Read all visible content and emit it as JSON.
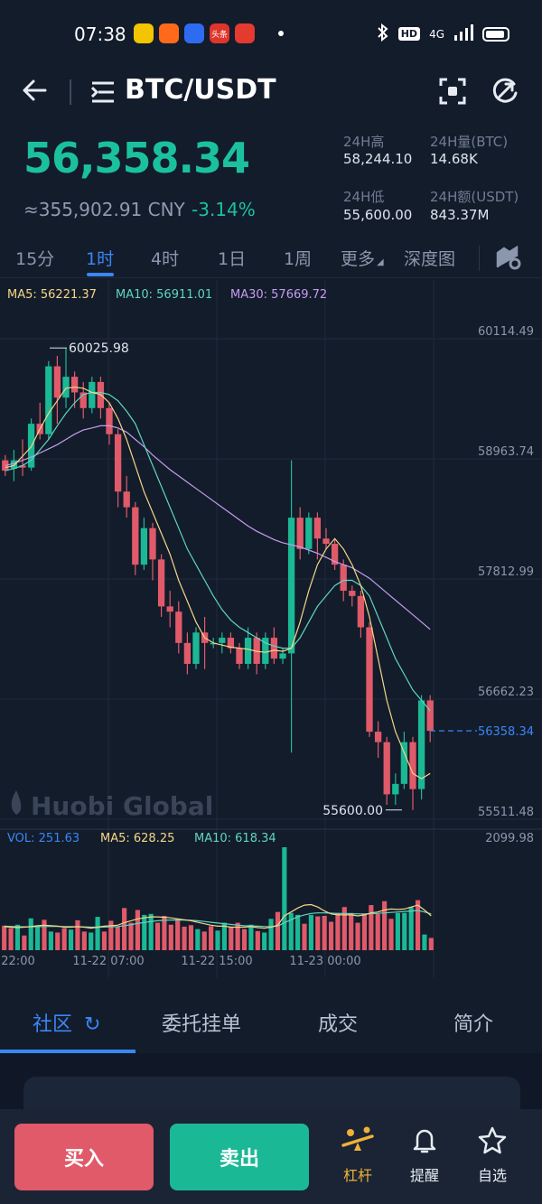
{
  "status": {
    "time": "07:38",
    "apps": [
      {
        "name": "chrome-app-icon",
        "color": "#f2c500"
      },
      {
        "name": "taobao-app-icon",
        "color": "#ff6a1a"
      },
      {
        "name": "baidu-app-icon",
        "color": "#2d6cf0"
      },
      {
        "name": "toutiao-app-icon",
        "color": "#e0352b",
        "label": "头条"
      },
      {
        "name": "video-app-icon",
        "color": "#e43a2f"
      }
    ],
    "network": "4G"
  },
  "header": {
    "pair": "BTC/USDT"
  },
  "price": {
    "last": "56,358.34",
    "cny": "≈355,902.91 CNY",
    "change": "-3.14%"
  },
  "stats": {
    "high_label": "24H高",
    "high_value": "58,244.10",
    "vol_label": "24H量(BTC)",
    "vol_value": "14.68K",
    "low_label": "24H低",
    "low_value": "55,600.00",
    "amt_label": "24H额(USDT)",
    "amt_value": "843.37M"
  },
  "tabs": [
    "15分",
    "1时",
    "4时",
    "1日",
    "1周",
    "更多",
    "深度图"
  ],
  "active_tab": "1时",
  "chart_data": {
    "type": "candlestick",
    "ma_legend": {
      "ma5": "MA5: 56221.37",
      "ma10": "MA10: 56911.01",
      "ma30": "MA30: 57669.72"
    },
    "ma_colors": {
      "ma5": "#f5d787",
      "ma10": "#5fd6c0",
      "ma30": "#c69cf0"
    },
    "up_color": "#1bb895",
    "down_color": "#e05a6a",
    "price_axis": [
      "60114.49",
      "58963.74",
      "57812.99",
      "56662.23",
      "55511.48"
    ],
    "price_axis_values": [
      60114.49,
      58963.74,
      57812.99,
      56662.23,
      55511.48
    ],
    "ylim": [
      55511.48,
      60114.49
    ],
    "last_price": "56358.34",
    "last_price_value": 56358.34,
    "max_label": "60025.98",
    "max_label_value": 60025.98,
    "min_label": "55600.00",
    "min_label_value": 55600.0,
    "watermark": "Huobi Global",
    "candles": [
      {
        "o": 58950,
        "c": 58850,
        "h": 59000,
        "l": 58800
      },
      {
        "o": 58870,
        "c": 58950,
        "h": 59050,
        "l": 58750
      },
      {
        "o": 58900,
        "c": 58880,
        "h": 59150,
        "l": 58800
      },
      {
        "o": 58880,
        "c": 59300,
        "h": 59350,
        "l": 58850
      },
      {
        "o": 59300,
        "c": 59200,
        "h": 59500,
        "l": 59150
      },
      {
        "o": 59200,
        "c": 59850,
        "h": 59900,
        "l": 59150
      },
      {
        "o": 59850,
        "c": 59550,
        "h": 59950,
        "l": 59300
      },
      {
        "o": 59550,
        "c": 59750,
        "h": 60026,
        "l": 59450
      },
      {
        "o": 59750,
        "c": 59600,
        "h": 59800,
        "l": 59450
      },
      {
        "o": 59600,
        "c": 59450,
        "h": 59700,
        "l": 59350
      },
      {
        "o": 59450,
        "c": 59700,
        "h": 59750,
        "l": 59400
      },
      {
        "o": 59700,
        "c": 59450,
        "h": 59750,
        "l": 59350
      },
      {
        "o": 59450,
        "c": 59200,
        "h": 59500,
        "l": 59100
      },
      {
        "o": 59200,
        "c": 58650,
        "h": 59250,
        "l": 58500
      },
      {
        "o": 58650,
        "c": 58500,
        "h": 58800,
        "l": 58400
      },
      {
        "o": 58500,
        "c": 57950,
        "h": 58550,
        "l": 57850
      },
      {
        "o": 57950,
        "c": 58300,
        "h": 58400,
        "l": 57900
      },
      {
        "o": 58300,
        "c": 58000,
        "h": 58350,
        "l": 57800
      },
      {
        "o": 58000,
        "c": 57550,
        "h": 58050,
        "l": 57450
      },
      {
        "o": 57550,
        "c": 57500,
        "h": 57700,
        "l": 57350
      },
      {
        "o": 57500,
        "c": 57200,
        "h": 57600,
        "l": 57100
      },
      {
        "o": 57200,
        "c": 57000,
        "h": 57300,
        "l": 56900
      },
      {
        "o": 57000,
        "c": 57300,
        "h": 57350,
        "l": 56950
      },
      {
        "o": 57300,
        "c": 57200,
        "h": 57450,
        "l": 56950
      },
      {
        "o": 57200,
        "c": 57200,
        "h": 57250,
        "l": 57150
      },
      {
        "o": 57200,
        "c": 57250,
        "h": 57300,
        "l": 57100
      },
      {
        "o": 57250,
        "c": 57150,
        "h": 57300,
        "l": 57100
      },
      {
        "o": 57150,
        "c": 57000,
        "h": 57200,
        "l": 56950
      },
      {
        "o": 57000,
        "c": 57250,
        "h": 57350,
        "l": 56950
      },
      {
        "o": 57250,
        "c": 57000,
        "h": 57300,
        "l": 56900
      },
      {
        "o": 57000,
        "c": 57250,
        "h": 57300,
        "l": 56950
      },
      {
        "o": 57250,
        "c": 57050,
        "h": 57350,
        "l": 57000
      },
      {
        "o": 57050,
        "c": 57100,
        "h": 57150,
        "l": 57000
      },
      {
        "o": 57100,
        "c": 58400,
        "h": 58950,
        "l": 56150
      },
      {
        "o": 58400,
        "c": 58100,
        "h": 58500,
        "l": 58000
      },
      {
        "o": 58100,
        "c": 58400,
        "h": 58450,
        "l": 58050
      },
      {
        "o": 58400,
        "c": 58200,
        "h": 58450,
        "l": 58000
      },
      {
        "o": 58200,
        "c": 58150,
        "h": 58300,
        "l": 58100
      },
      {
        "o": 58150,
        "c": 57950,
        "h": 58200,
        "l": 57900
      },
      {
        "o": 57950,
        "c": 57700,
        "h": 58000,
        "l": 57600
      },
      {
        "o": 57700,
        "c": 57650,
        "h": 57750,
        "l": 57550
      },
      {
        "o": 57650,
        "c": 57350,
        "h": 57700,
        "l": 57250
      },
      {
        "o": 57350,
        "c": 56350,
        "h": 57400,
        "l": 56300
      },
      {
        "o": 56350,
        "c": 56250,
        "h": 56450,
        "l": 56100
      },
      {
        "o": 56250,
        "c": 55750,
        "h": 56300,
        "l": 55650
      },
      {
        "o": 55750,
        "c": 55850,
        "h": 55950,
        "l": 55650
      },
      {
        "o": 55850,
        "c": 56250,
        "h": 56350,
        "l": 55800
      },
      {
        "o": 56250,
        "c": 55800,
        "h": 56300,
        "l": 55600
      },
      {
        "o": 55800,
        "c": 56650,
        "h": 56700,
        "l": 55700
      },
      {
        "o": 56650,
        "c": 56358,
        "h": 56700,
        "l": 56250
      }
    ],
    "ma5_line": [
      58880,
      58900,
      58990,
      59080,
      59250,
      59400,
      59520,
      59640,
      59650,
      59640,
      59600,
      59580,
      59500,
      59350,
      59150,
      58900,
      58650,
      58450,
      58250,
      58050,
      57800,
      57600,
      57400,
      57250,
      57200,
      57180,
      57160,
      57150,
      57140,
      57120,
      57110,
      57130,
      57120,
      57150,
      57400,
      57700,
      57950,
      58100,
      58200,
      58100,
      57950,
      57750,
      57450,
      57050,
      56650,
      56350,
      56150,
      55950,
      55900,
      55950
    ],
    "ma10_line": [
      58850,
      58870,
      58900,
      58950,
      59050,
      59150,
      59280,
      59400,
      59500,
      59580,
      59600,
      59600,
      59580,
      59520,
      59420,
      59300,
      59100,
      58900,
      58700,
      58500,
      58300,
      58100,
      57950,
      57800,
      57650,
      57520,
      57420,
      57350,
      57300,
      57250,
      57200,
      57170,
      57150,
      57150,
      57250,
      57400,
      57550,
      57650,
      57750,
      57800,
      57800,
      57750,
      57650,
      57450,
      57250,
      57050,
      56900,
      56750,
      56650,
      56550
    ],
    "ma30_line": [
      58900,
      58920,
      58950,
      58980,
      59020,
      59060,
      59100,
      59150,
      59200,
      59240,
      59260,
      59280,
      59280,
      59260,
      59220,
      59150,
      59080,
      59000,
      58930,
      58860,
      58800,
      58740,
      58680,
      58620,
      58560,
      58500,
      58440,
      58380,
      58320,
      58270,
      58230,
      58190,
      58160,
      58140,
      58120,
      58090,
      58060,
      58020,
      57980,
      57950,
      57920,
      57870,
      57820,
      57750,
      57680,
      57610,
      57540,
      57470,
      57400,
      57330
    ],
    "volume": {
      "legend_vol": "VOL: 251.63",
      "legend_ma5": "MA5: 628.25",
      "legend_ma10": "MA10: 618.34",
      "max_label": "2099.98",
      "max": 2099.98,
      "values": [
        500,
        450,
        520,
        300,
        650,
        480,
        620,
        380,
        360,
        450,
        420,
        610,
        380,
        360,
        680,
        380,
        600,
        480,
        860,
        560,
        820,
        720,
        740,
        560,
        700,
        520,
        640,
        480,
        510,
        430,
        380,
        490,
        400,
        560,
        470,
        560,
        430,
        520,
        390,
        360,
        640,
        780,
        2099.98,
        760,
        720,
        540,
        720,
        690,
        700,
        580,
        760,
        880,
        760,
        560,
        740,
        920,
        740,
        1000,
        640,
        760,
        760,
        880,
        1020,
        320,
        250
      ],
      "ma5_line": [
        480,
        470,
        460,
        470,
        480,
        500,
        510,
        500,
        490,
        470,
        470,
        480,
        470,
        450,
        470,
        490,
        500,
        510,
        560,
        600,
        640,
        660,
        680,
        680,
        670,
        660,
        640,
        620,
        600,
        570,
        540,
        510,
        490,
        490,
        470,
        470,
        470,
        480,
        460,
        450,
        470,
        510,
        700,
        780,
        860,
        920,
        930,
        880,
        800,
        740,
        720,
        720,
        720,
        700,
        720,
        760,
        780,
        820,
        840,
        830,
        840,
        880,
        920,
        820,
        700
      ],
      "ma10_line": [
        490,
        485,
        480,
        478,
        478,
        480,
        482,
        485,
        485,
        482,
        480,
        478,
        475,
        470,
        470,
        472,
        476,
        482,
        500,
        520,
        545,
        565,
        585,
        600,
        610,
        615,
        618,
        615,
        610,
        600,
        585,
        570,
        555,
        540,
        525,
        512,
        500,
        495,
        490,
        485,
        482,
        490,
        560,
        620,
        680,
        720,
        750,
        760,
        760,
        755,
        750,
        748,
        745,
        740,
        740,
        745,
        752,
        760,
        770,
        780,
        790,
        800,
        810,
        780,
        740
      ]
    },
    "time_labels": [
      "22:00",
      "11-22 07:00",
      "11-22 15:00",
      "11-23 00:00"
    ]
  },
  "bottom_tabs": [
    "社区",
    "委托挂单",
    "成交",
    "简介"
  ],
  "actions": {
    "buy": "买入",
    "sell": "卖出",
    "leverage": "杠杆",
    "alert": "提醒",
    "favorite": "自选"
  }
}
